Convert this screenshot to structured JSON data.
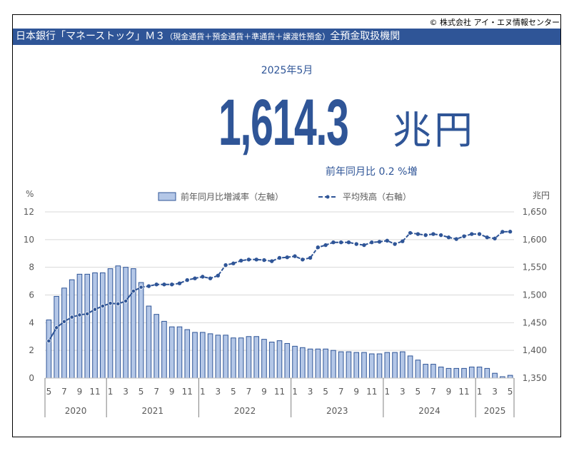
{
  "header": {
    "copyright": "© 株式会社 アイ・エヌ情報センター",
    "title_main": "日本銀行「マネーストック」Ｍ３",
    "title_sub": "（現金通貨＋預金通貨＋準通貨＋譲渡性預金）",
    "title_tail": "全預金取扱機関"
  },
  "summary": {
    "month": "2025年5月",
    "value": "1,614.3",
    "unit": "兆円",
    "yoy_label": "前年同月比",
    "yoy_value": "0.2",
    "yoy_suffix": "%増"
  },
  "colors": {
    "accent": "#2F5597",
    "bar_fill": "#B4C7E7",
    "bar_stroke": "#2F5597"
  },
  "chart_data": {
    "type": "bar+line",
    "left_axis": {
      "label": "%",
      "ticks": [
        "0",
        "2",
        "4",
        "6",
        "8",
        "10",
        "12"
      ],
      "range": [
        0,
        12
      ]
    },
    "right_axis": {
      "label": "兆円",
      "ticks": [
        "1,350",
        "1,400",
        "1,450",
        "1,500",
        "1,550",
        "1,600",
        "1,650"
      ],
      "range": [
        1350,
        1650
      ]
    },
    "legend": [
      "前年同月比増減率（左軸）",
      "平均残高（右軸）"
    ],
    "legend_position": "top",
    "years": [
      {
        "label": "2020",
        "months": 8
      },
      {
        "label": "2021",
        "months": 12
      },
      {
        "label": "2022",
        "months": 12
      },
      {
        "label": "2023",
        "months": 12
      },
      {
        "label": "2024",
        "months": 12
      },
      {
        "label": "2025",
        "months": 5
      }
    ],
    "months": [
      5,
      6,
      7,
      8,
      9,
      10,
      11,
      12,
      1,
      2,
      3,
      4,
      5,
      6,
      7,
      8,
      9,
      10,
      11,
      12,
      1,
      2,
      3,
      4,
      5,
      6,
      7,
      8,
      9,
      10,
      11,
      12,
      1,
      2,
      3,
      4,
      5,
      6,
      7,
      8,
      9,
      10,
      11,
      12,
      1,
      2,
      3,
      4,
      5,
      6,
      7,
      8,
      9,
      10,
      11,
      12,
      1,
      2,
      3,
      4,
      5
    ],
    "series": [
      {
        "name": "前年同月比増減率（左軸）",
        "axis": "left",
        "type": "bar",
        "values": [
          4.2,
          5.9,
          6.5,
          7.1,
          7.5,
          7.5,
          7.6,
          7.6,
          7.9,
          8.1,
          8.0,
          7.9,
          6.9,
          5.2,
          4.6,
          4.1,
          3.7,
          3.7,
          3.5,
          3.3,
          3.3,
          3.2,
          3.1,
          3.1,
          2.9,
          2.9,
          3.0,
          3.0,
          2.8,
          2.6,
          2.7,
          2.5,
          2.3,
          2.2,
          2.1,
          2.1,
          2.1,
          2.0,
          1.9,
          1.9,
          1.85,
          1.85,
          1.75,
          1.75,
          1.85,
          1.85,
          1.9,
          1.6,
          1.3,
          1.0,
          1.0,
          0.8,
          0.7,
          0.7,
          0.7,
          0.8,
          0.8,
          0.7,
          0.35,
          0.1,
          0.2
        ]
      },
      {
        "name": "平均残高（右軸）",
        "axis": "right",
        "type": "line",
        "values": [
          1417,
          1441,
          1452,
          1460,
          1464,
          1466,
          1474,
          1480,
          1485,
          1484,
          1489,
          1507,
          1514,
          1516,
          1519,
          1519,
          1519,
          1521,
          1527,
          1530,
          1533,
          1530,
          1535,
          1554,
          1557,
          1562,
          1564,
          1564,
          1563,
          1561,
          1567,
          1568,
          1570,
          1564,
          1567,
          1586,
          1590,
          1595,
          1595,
          1595,
          1592,
          1590,
          1595,
          1596,
          1598,
          1592,
          1597,
          1612,
          1610,
          1608,
          1610,
          1608,
          1604,
          1601,
          1606,
          1610,
          1610,
          1604,
          1602,
          1614,
          1614.3
        ]
      }
    ]
  }
}
